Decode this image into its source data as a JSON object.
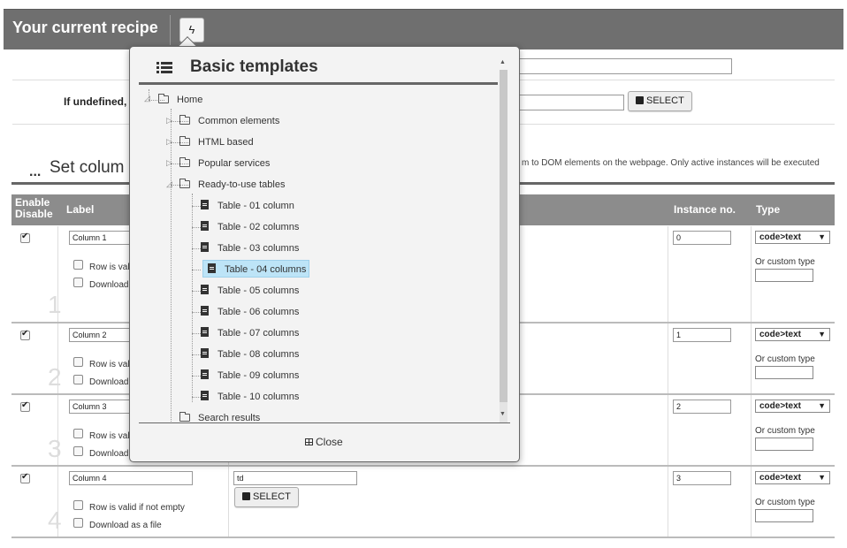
{
  "header": {
    "title": "Your current recipe",
    "action_icon": "bolt-icon"
  },
  "config": {
    "if_undefined_label": "If undefined,",
    "select_label": "SELECT"
  },
  "section": {
    "dots": "...",
    "title": "Set colum",
    "description": "m to DOM elements on the webpage. Only active instances will be executed"
  },
  "table": {
    "headers": {
      "enable": "Enable",
      "disable": "Disable",
      "label": "Label",
      "instance": "Instance no.",
      "type": "Type"
    },
    "rows": [
      {
        "num": "1",
        "label": "Column 1",
        "instance": "0",
        "type": "code>text",
        "valid": "Row is vali",
        "download": "Download",
        "custom": "Or custom type",
        "selector": ""
      },
      {
        "num": "2",
        "label": "Column 2",
        "instance": "1",
        "type": "code>text",
        "valid": "Row is vali",
        "download": "Download",
        "custom": "Or custom type",
        "selector": ""
      },
      {
        "num": "3",
        "label": "Column 3",
        "instance": "2",
        "type": "code>text",
        "valid": "Row is vali",
        "download": "Download",
        "custom": "Or custom type",
        "selector": ""
      },
      {
        "num": "4",
        "label": "Column 4",
        "instance": "3",
        "type": "code>text",
        "valid": "Row is valid if not empty",
        "download": "Download as a file",
        "custom": "Or custom type",
        "selector": "td"
      }
    ]
  },
  "popup": {
    "title": "Basic templates",
    "close_label": "Close",
    "tree": {
      "root": "Home",
      "folders": [
        "Common elements",
        "HTML based",
        "Popular services",
        "Ready-to-use tables"
      ],
      "tables": [
        "Table - 01 column",
        "Table - 02 columns",
        "Table - 03 columns",
        "Table - 04 columns",
        "Table - 05 columns",
        "Table - 06 columns",
        "Table - 07 columns",
        "Table - 08 columns",
        "Table - 09 columns",
        "Table - 10 columns"
      ],
      "selected": "Table - 04 columns",
      "search": "Search results"
    }
  },
  "colors": {
    "header_bg": "#6f6f6f",
    "table_header_bg": "#8c8c8c",
    "selected_bg": "#bde4f7"
  }
}
